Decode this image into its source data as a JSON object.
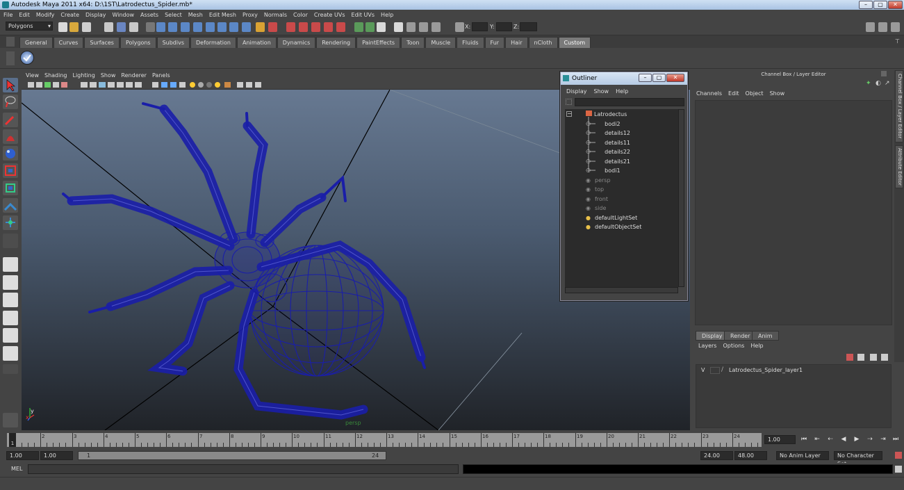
{
  "window": {
    "title": "Autodesk Maya 2011 x64: D:\\1ST\\Latrodectus_Spider.mb*",
    "min": "–",
    "max": "▢",
    "close": "✕"
  },
  "menubar": [
    "File",
    "Edit",
    "Modify",
    "Create",
    "Display",
    "Window",
    "Assets",
    "Select",
    "Mesh",
    "Edit Mesh",
    "Proxy",
    "Normals",
    "Color",
    "Create UVs",
    "Edit UVs",
    "Help"
  ],
  "statusline": {
    "menuset": "Polygons",
    "x_label": "X:",
    "y_label": "Y:",
    "z_label": "Z:"
  },
  "shelf_tabs": [
    "General",
    "Curves",
    "Surfaces",
    "Polygons",
    "Subdivs",
    "Deformation",
    "Animation",
    "Dynamics",
    "Rendering",
    "PaintEffects",
    "Toon",
    "Muscle",
    "Fluids",
    "Fur",
    "Hair",
    "nCloth",
    "Custom"
  ],
  "active_shelf": "Custom",
  "viewport": {
    "menu": [
      "View",
      "Shading",
      "Lighting",
      "Show",
      "Renderer",
      "Panels"
    ],
    "camera_label": "persp",
    "axis_x": "x",
    "axis_y": "y"
  },
  "outliner": {
    "title": "Outliner",
    "menu": [
      "Display",
      "Show",
      "Help"
    ],
    "items": [
      {
        "label": "Latrodectus",
        "kind": "group",
        "dim": false
      },
      {
        "label": "bodi2",
        "kind": "mesh",
        "dim": false
      },
      {
        "label": "details12",
        "kind": "mesh",
        "dim": false
      },
      {
        "label": "details11",
        "kind": "mesh",
        "dim": false
      },
      {
        "label": "details22",
        "kind": "mesh",
        "dim": false
      },
      {
        "label": "details21",
        "kind": "mesh",
        "dim": false
      },
      {
        "label": "bodi1",
        "kind": "mesh",
        "dim": false
      },
      {
        "label": "persp",
        "kind": "camera",
        "dim": true
      },
      {
        "label": "top",
        "kind": "camera",
        "dim": true
      },
      {
        "label": "front",
        "kind": "camera",
        "dim": true
      },
      {
        "label": "side",
        "kind": "camera",
        "dim": true
      },
      {
        "label": "defaultLightSet",
        "kind": "set",
        "dim": false
      },
      {
        "label": "defaultObjectSet",
        "kind": "set",
        "dim": false
      }
    ]
  },
  "channelbox": {
    "title": "Channel Box / Layer Editor",
    "menu": [
      "Channels",
      "Edit",
      "Object",
      "Show"
    ]
  },
  "side_tabs": [
    "Channel Box / Layer Editor",
    "Attribute Editor"
  ],
  "layer_editor": {
    "tabs": [
      "Display",
      "Render",
      "Anim"
    ],
    "active_tab": "Display",
    "menu": [
      "Layers",
      "Options",
      "Help"
    ],
    "layers": [
      {
        "visible": "V",
        "name": "Latrodectus_Spider_layer1"
      }
    ]
  },
  "timeline": {
    "ticks": [
      "1",
      "2",
      "3",
      "4",
      "5",
      "6",
      "7",
      "8",
      "9",
      "10",
      "11",
      "12",
      "13",
      "14",
      "15",
      "16",
      "17",
      "18",
      "19",
      "20",
      "21",
      "22",
      "23",
      "24"
    ],
    "current_frame": "1",
    "current_time_field": "1.00"
  },
  "range": {
    "start": "1.00",
    "inner_start": "1.00",
    "slider_start": "1",
    "slider_end": "24",
    "end": "24.00",
    "outer_end": "48.00",
    "anim_layer": "No Anim Layer",
    "char_set": "No Character Set"
  },
  "command_line": {
    "label": "MEL"
  },
  "colors": {
    "wire": "#1a1ea8",
    "accent": "#d5e4f6"
  }
}
